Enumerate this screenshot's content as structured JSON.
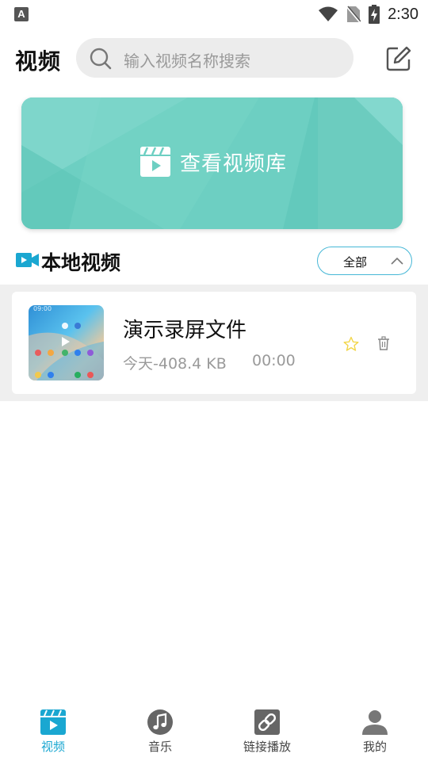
{
  "status_bar": {
    "left_badge": "A",
    "time": "2:30",
    "icons": [
      "wifi-icon",
      "no-sim-icon",
      "battery-charging-icon"
    ]
  },
  "header": {
    "title": "视频",
    "search_placeholder": "输入视频名称搜索",
    "edit_icon": "edit-icon"
  },
  "banner": {
    "label": "查看视频库",
    "icon": "video-clapper-icon",
    "color": "#6fd0c3"
  },
  "section": {
    "title": "本地视频",
    "filter_label": "全部",
    "accent": "#1aa7d1"
  },
  "videos": [
    {
      "title": "演示录屏文件",
      "meta": "今天-408.4 KB",
      "duration": "00:00",
      "starred": false
    }
  ],
  "bottom_nav": {
    "items": [
      {
        "label": "视频",
        "icon": "video-tab-icon",
        "active": true
      },
      {
        "label": "音乐",
        "icon": "music-icon",
        "active": false
      },
      {
        "label": "链接播放",
        "icon": "link-icon",
        "active": false
      },
      {
        "label": "我的",
        "icon": "profile-icon",
        "active": false
      }
    ],
    "active_color": "#1aa7d1"
  }
}
